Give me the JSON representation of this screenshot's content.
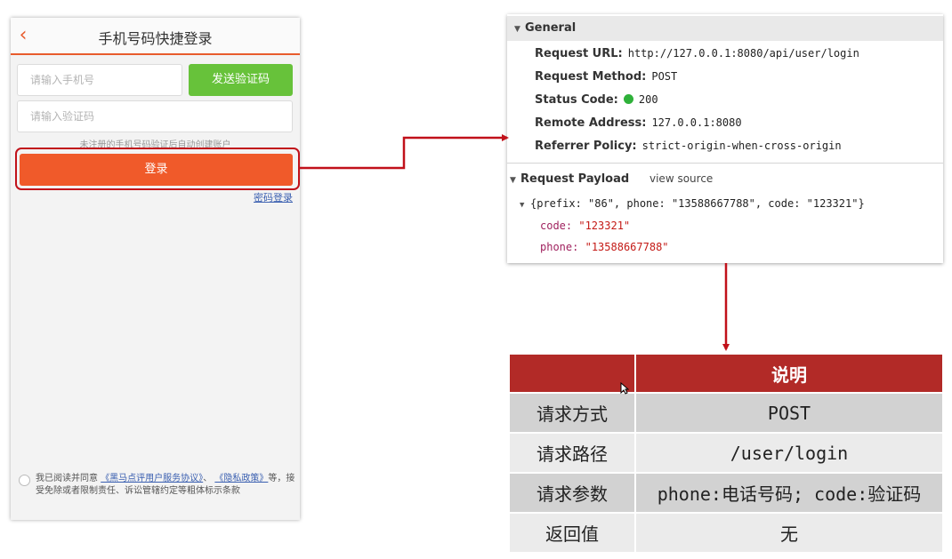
{
  "login": {
    "title": "手机号码快捷登录",
    "back_icon": "chevron-left-icon",
    "phone_placeholder": "请输入手机号",
    "send_code_label": "发送验证码",
    "code_placeholder": "请输入验证码",
    "hint": "未注册的手机号码验证后自动创建账户",
    "login_label": "登录",
    "password_login_link": "密码登录",
    "agreement": {
      "prefix": "我已阅读并同意",
      "link1": "《黑马点评用户服务协议》",
      "sep": "、",
      "link2": "《隐私政策》",
      "suffix": "等，接受免除或者限制责任、诉讼管辖约定等粗体标示条款"
    },
    "accent_color": "#f05a2a",
    "send_button_color": "#67c23a"
  },
  "devtools": {
    "general_header": "General",
    "request_url_label": "Request URL:",
    "request_url": "http://127.0.0.1:8080/api/user/login",
    "request_method_label": "Request Method:",
    "request_method": "POST",
    "status_code_label": "Status Code:",
    "status_code": "200",
    "status_color": "#2fb13a",
    "remote_address_label": "Remote Address:",
    "remote_address": "127.0.0.1:8080",
    "referrer_policy_label": "Referrer Policy:",
    "referrer_policy": "strict-origin-when-cross-origin",
    "payload_header": "Request Payload",
    "view_source": "view source",
    "payload_summary": "{prefix: \"86\", phone: \"13588667788\", code: \"123321\"}",
    "props": [
      {
        "key": "code:",
        "value": "\"123321\""
      },
      {
        "key": "phone:",
        "value": "\"13588667788\""
      }
    ]
  },
  "spec_table": {
    "header_col1": "",
    "header_col2": "说明",
    "rows": [
      {
        "key": "请求方式",
        "value": "POST"
      },
      {
        "key": "请求路径",
        "value": "/user/login"
      },
      {
        "key": "请求参数",
        "value": "phone:电话号码; code:验证码"
      },
      {
        "key": "返回值",
        "value": "无"
      }
    ],
    "header_color": "#b22a27"
  },
  "arrow_color": "#c1111a"
}
